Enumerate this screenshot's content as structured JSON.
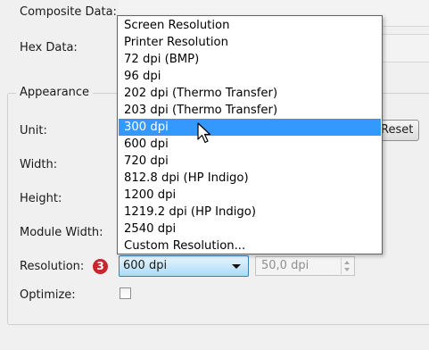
{
  "labels": {
    "composite_data": "Composite Data:",
    "hex_data": "Hex Data:",
    "appearance": "Appearance",
    "unit": "Unit:",
    "width": "Width:",
    "height": "Height:",
    "module_width": "Module Width:",
    "resolution": "Resolution:",
    "optimize": "Optimize:"
  },
  "reset_label": "Reset",
  "resolution_menu": {
    "items": [
      "Screen Resolution",
      "Printer Resolution",
      "72 dpi (BMP)",
      "96 dpi",
      "202 dpi (Thermo Transfer)",
      "203 dpi (Thermo Transfer)",
      "300 dpi",
      "600 dpi",
      "720 dpi",
      "812.8 dpi (HP Indigo)",
      "1200 dpi",
      "1219.2 dpi (HP Indigo)",
      "2540 dpi",
      "Custom Resolution..."
    ],
    "highlighted": "300 dpi"
  },
  "resolution_select": {
    "value": "600 dpi"
  },
  "custom_dpi": {
    "value": "50,0 dpi"
  },
  "callout_number": "3",
  "optimize_checked": false,
  "colors": {
    "highlight": "#3399ff",
    "callout": "#c8262c"
  }
}
